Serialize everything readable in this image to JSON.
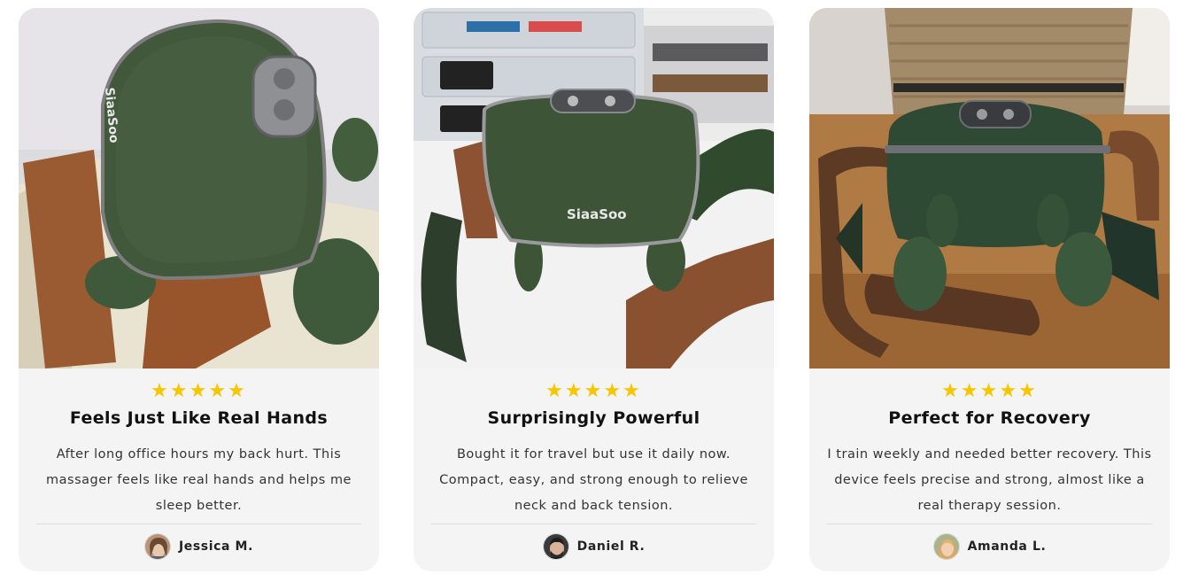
{
  "reviews": [
    {
      "rating": 5,
      "stars": "★★★★★",
      "photo_brand": "SiaaSoo",
      "title": "Feels Just Like Real Hands",
      "text": "After long office hours my back hurt. This massager feels like real hands and helps me sleep better.",
      "reviewer": "Jessica M."
    },
    {
      "rating": 5,
      "stars": "★★★★★",
      "photo_brand": "SiaaSoo",
      "title": "Surprisingly Powerful",
      "text": "Bought it for travel but use it daily now. Compact, easy, and strong enough to relieve neck and back tension.",
      "reviewer": "Daniel R."
    },
    {
      "rating": 5,
      "stars": "★★★★★",
      "title": "Perfect for Recovery",
      "text": "I train weekly and needed better recovery. This device feels precise and strong, almost like a real therapy session.",
      "reviewer": "Amanda L."
    }
  ],
  "colors": {
    "star": "#f7c600",
    "card_bg": "#f4f4f4",
    "massager_green": "#3e5436",
    "strap_brown": "#8a5232"
  }
}
